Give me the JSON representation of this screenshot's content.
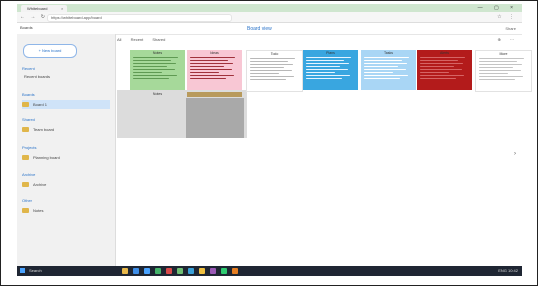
{
  "browser": {
    "tab_title": "Whiteboard",
    "tab_close": "×",
    "window_controls": "— ▢ ×",
    "nav_icons": "← → ↻",
    "url": "https://whiteboard.app/board",
    "extension_icons": "☆ ⋮"
  },
  "app": {
    "brand": "Boards",
    "title": "Board view",
    "actions": "Share"
  },
  "sidebar": {
    "new_button": "+ New board",
    "sections": [
      {
        "heading": "Recent",
        "items": [
          {
            "label": "Recent boards"
          }
        ]
      },
      {
        "heading": "Boards",
        "items": [
          {
            "label": "Board 1",
            "selected": true
          }
        ]
      },
      {
        "heading": "Shared",
        "items": [
          {
            "label": "Team board"
          }
        ]
      },
      {
        "heading": "Projects",
        "items": [
          {
            "label": "Planning board"
          }
        ]
      },
      {
        "heading": "Archive",
        "items": [
          {
            "label": "Archive"
          }
        ]
      },
      {
        "heading": "Other",
        "items": [
          {
            "label": "Notes"
          }
        ]
      }
    ]
  },
  "toolbar": {
    "filters": [
      "All",
      "Recent",
      "Shared"
    ],
    "right_actions": "⊕ ⋯"
  },
  "board": {
    "cards": [
      {
        "title": "Notes",
        "footer": "Notes",
        "bg": "#a6d99a",
        "line": "#5f9a53"
      },
      {
        "title": "Ideas",
        "footer": "",
        "bg": "#f8c7d4",
        "line": "#a0323c"
      },
      {
        "title": "Todo",
        "footer": "",
        "bg": "#ffffff",
        "line": "#b8b8b8"
      },
      {
        "title": "Plans",
        "footer": "",
        "bg": "#39a6e0",
        "line": "#e6f4ff"
      },
      {
        "title": "Tasks",
        "footer": "",
        "bg": "#a9d6f5",
        "line": "#ffffff"
      },
      {
        "title": "Alerts",
        "footer": "",
        "bg": "#b31b1b",
        "line": "#d66464"
      },
      {
        "title": "More",
        "footer": "",
        "bg": "#ffffff",
        "line": "#c4c4c4"
      }
    ],
    "side_arrow": "›"
  },
  "taskbar": {
    "left_text": "Search",
    "apps": [
      {
        "name": "file-explorer-icon",
        "color": "#e8b84a"
      },
      {
        "name": "browser-icon",
        "color": "#3e8ee8"
      },
      {
        "name": "mail-icon",
        "color": "#4aa3ff"
      },
      {
        "name": "store-icon",
        "color": "#44b36a"
      },
      {
        "name": "app-icon",
        "color": "#d94a4a"
      },
      {
        "name": "app-icon-2",
        "color": "#6fbf73"
      },
      {
        "name": "app-icon-3",
        "color": "#3aa0d8"
      },
      {
        "name": "app-icon-4",
        "color": "#f0c040"
      },
      {
        "name": "app-icon-5",
        "color": "#9b59b6"
      },
      {
        "name": "app-icon-6",
        "color": "#2ecc71"
      },
      {
        "name": "app-icon-7",
        "color": "#e67e22"
      }
    ],
    "right_text": "ENG 10:42"
  }
}
